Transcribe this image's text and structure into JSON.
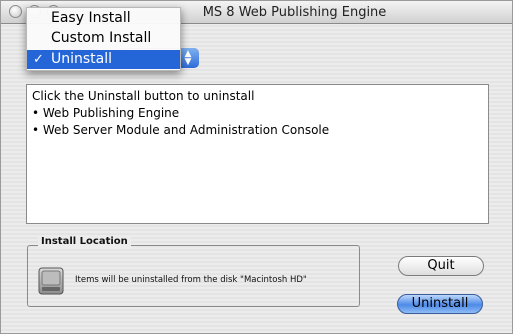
{
  "window": {
    "title": "MS 8 Web Publishing Engine"
  },
  "popup_menu": {
    "items": [
      {
        "label": "Easy Install",
        "selected": false
      },
      {
        "label": "Custom Install",
        "selected": false
      },
      {
        "label": "Uninstall",
        "selected": true
      }
    ],
    "check_glyph": "✓"
  },
  "message": {
    "line1": "Click the Uninstall button to uninstall",
    "bullets": [
      "• Web Publishing Engine",
      "• Web Server Module and Administration Console"
    ]
  },
  "install_location": {
    "title": "Install Location",
    "icon": "hard-disk-icon",
    "description": "Items will be uninstalled from the disk \"Macintosh HD\""
  },
  "buttons": {
    "quit": "Quit",
    "uninstall": "Uninstall"
  },
  "colors": {
    "menu_highlight": "#2466d8",
    "default_button": "#4d8ae8"
  }
}
